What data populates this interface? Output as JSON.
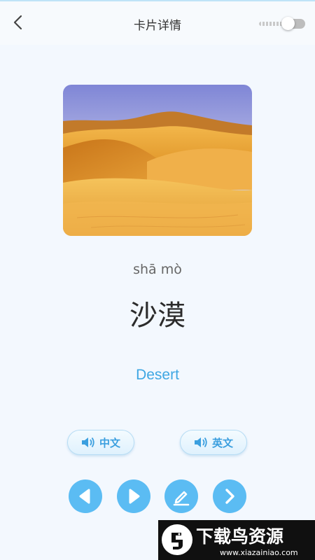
{
  "header": {
    "title": "卡片详情",
    "back_icon": "chevron-left-icon",
    "toggle_on": false
  },
  "card": {
    "image_alt": "desert",
    "pinyin": "shā mò",
    "hanzi": "沙漠",
    "english": "Desert"
  },
  "audio_buttons": [
    {
      "label": "中文",
      "icon": "speaker-icon"
    },
    {
      "label": "英文",
      "icon": "speaker-icon"
    }
  ],
  "controls": [
    {
      "name": "previous",
      "icon": "triangle-left-icon"
    },
    {
      "name": "play",
      "icon": "triangle-right-icon"
    },
    {
      "name": "edit",
      "icon": "pencil-icon"
    },
    {
      "name": "next",
      "icon": "chevron-right-icon"
    }
  ],
  "watermark": {
    "text": "下载鸟资源",
    "url_text": "www.xiazainiao.com"
  },
  "colors": {
    "accent": "#5bbcf3",
    "english_text": "#3fa7e3",
    "background": "#f3f8fe"
  }
}
